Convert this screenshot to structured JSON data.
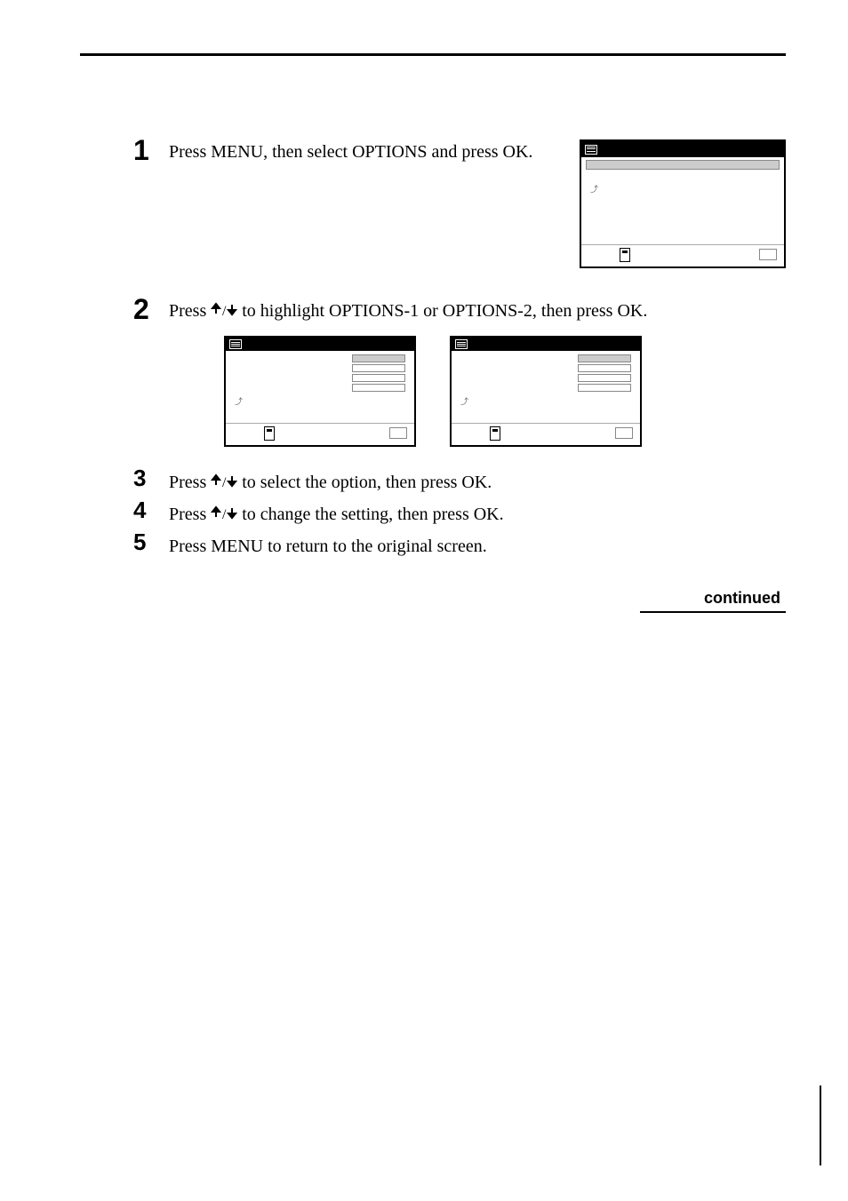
{
  "steps": {
    "s1": {
      "num": "1",
      "text": "Press MENU, then select OPTIONS and press OK."
    },
    "s2": {
      "num": "2",
      "prefix": "Press ",
      "suffix": " to highlight OPTIONS-1 or OPTIONS-2, then press OK."
    },
    "s3": {
      "num": "3",
      "prefix": "Press ",
      "suffix": " to select the option, then press OK."
    },
    "s4": {
      "num": "4",
      "prefix": "Press ",
      "suffix": " to change the setting, then press OK."
    },
    "s5": {
      "num": "5",
      "text": "Press MENU to return to the original screen."
    }
  },
  "continued": "continued"
}
